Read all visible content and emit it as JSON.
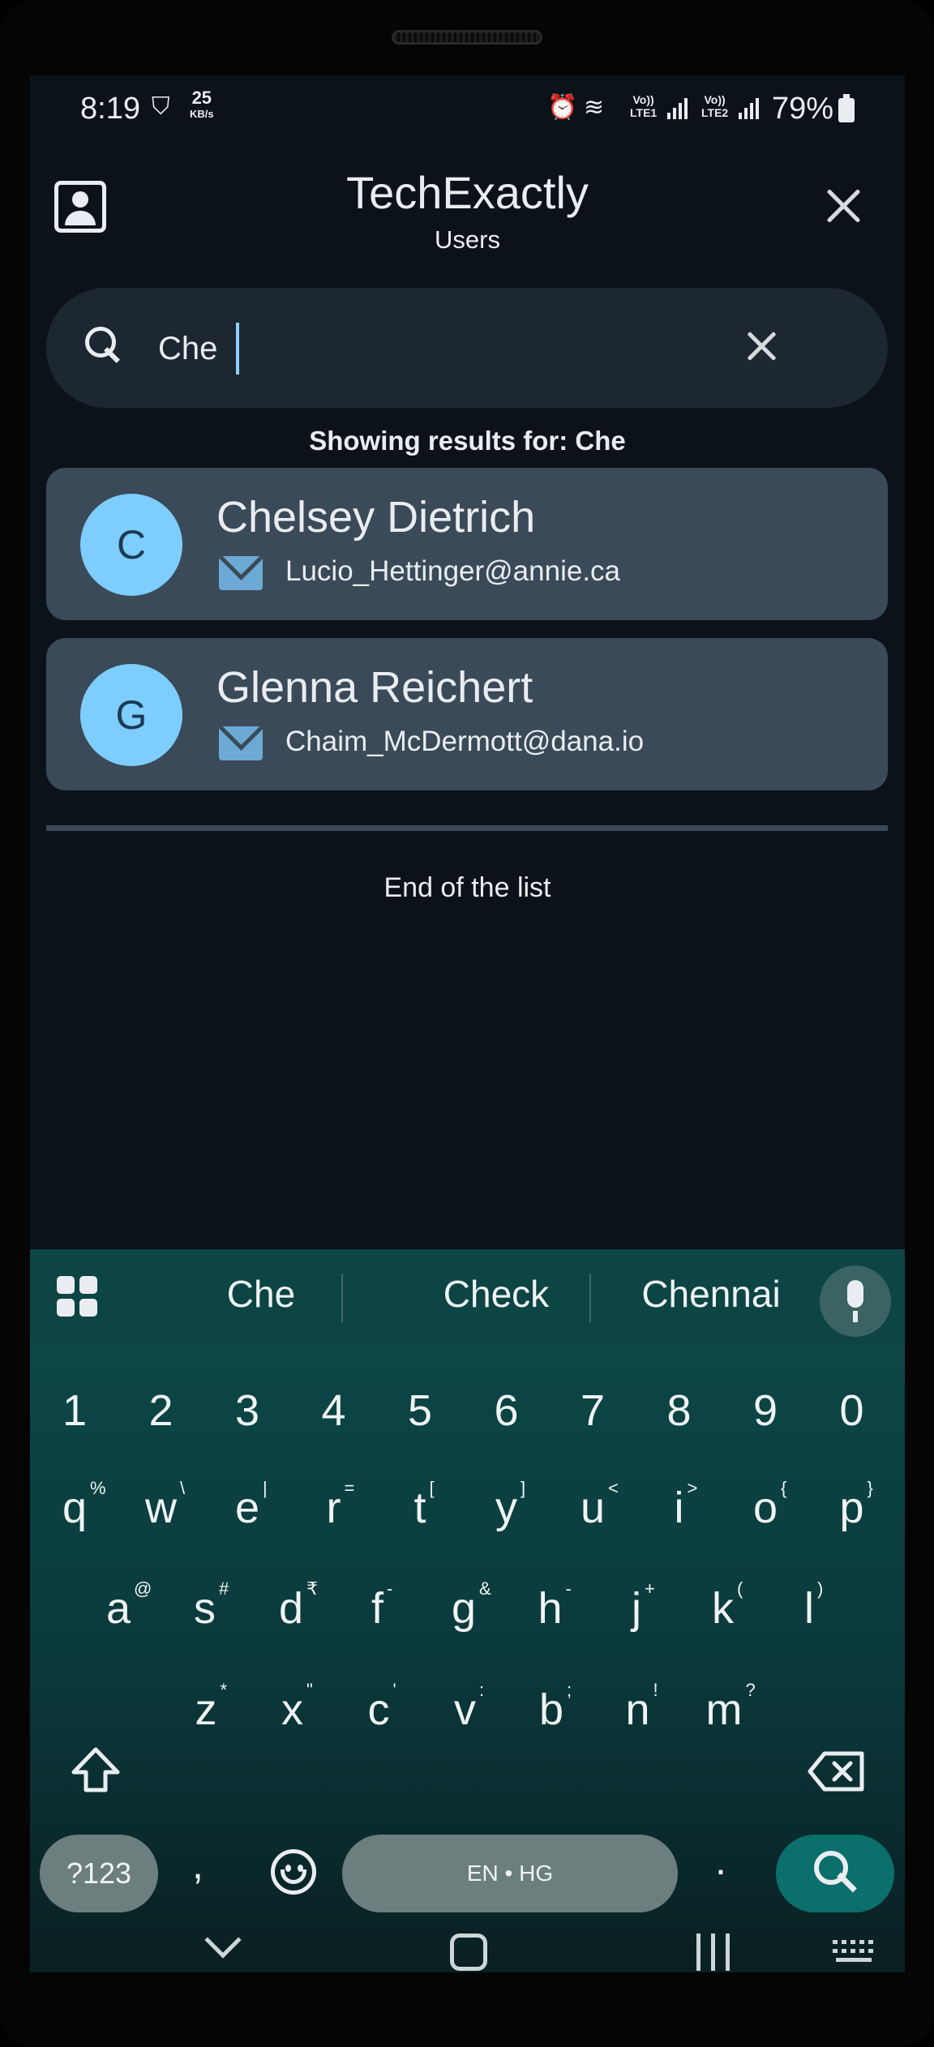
{
  "status_bar": {
    "time": "8:19",
    "net_speed_value": "25",
    "net_speed_unit": "KB/s",
    "sim1_label_top": "Vo))",
    "sim1_label_bottom": "LTE1",
    "sim2_label_top": "Vo))",
    "sim2_label_bottom": "LTE2",
    "battery": "79%"
  },
  "header": {
    "title": "TechExactly",
    "subtitle": "Users"
  },
  "search": {
    "value": "Che",
    "placeholder": ""
  },
  "results_label": "Showing results for: Che",
  "users": [
    {
      "initial": "C",
      "name": "Chelsey Dietrich",
      "email": "Lucio_Hettinger@annie.ca"
    },
    {
      "initial": "G",
      "name": "Glenna Reichert",
      "email": "Chaim_McDermott@dana.io"
    }
  ],
  "end_of_list": "End of the list",
  "keyboard": {
    "suggestions": [
      "Che",
      "Check",
      "Chennai"
    ],
    "number_row": [
      "1",
      "2",
      "3",
      "4",
      "5",
      "6",
      "7",
      "8",
      "9",
      "0"
    ],
    "row1": [
      [
        "q",
        "%"
      ],
      [
        "w",
        "\\"
      ],
      [
        "e",
        "|"
      ],
      [
        "r",
        "="
      ],
      [
        "t",
        "["
      ],
      [
        "y",
        "]"
      ],
      [
        "u",
        "<"
      ],
      [
        "i",
        ">"
      ],
      [
        "o",
        "{"
      ],
      [
        "p",
        "}"
      ]
    ],
    "row2": [
      [
        "a",
        "@"
      ],
      [
        "s",
        "#"
      ],
      [
        "d",
        "₹"
      ],
      [
        "f",
        "-"
      ],
      [
        "g",
        "&"
      ],
      [
        "h",
        "-"
      ],
      [
        "j",
        "+"
      ],
      [
        "k",
        "("
      ],
      [
        "l",
        ")"
      ]
    ],
    "row3": [
      [
        "z",
        "*"
      ],
      [
        "x",
        "\""
      ],
      [
        "c",
        "'"
      ],
      [
        "v",
        ":"
      ],
      [
        "b",
        ";"
      ],
      [
        "n",
        "!"
      ],
      [
        "m",
        "?"
      ]
    ],
    "symbols_key": "?123",
    "comma_key": ",",
    "space_label": "EN • HG",
    "period_key": "."
  },
  "colors": {
    "background": "#0b121a",
    "card": "#3b4a58",
    "avatar": "#7dcdff",
    "keyboard": "#0c4a4a",
    "action_key": "#0b6f6b"
  },
  "icons": [
    "profile-icon",
    "close-icon",
    "search-icon",
    "clear-icon",
    "mail-icon",
    "grid-icon",
    "mic-icon",
    "shift-icon",
    "backspace-icon",
    "emoji-icon",
    "search-action-icon"
  ]
}
